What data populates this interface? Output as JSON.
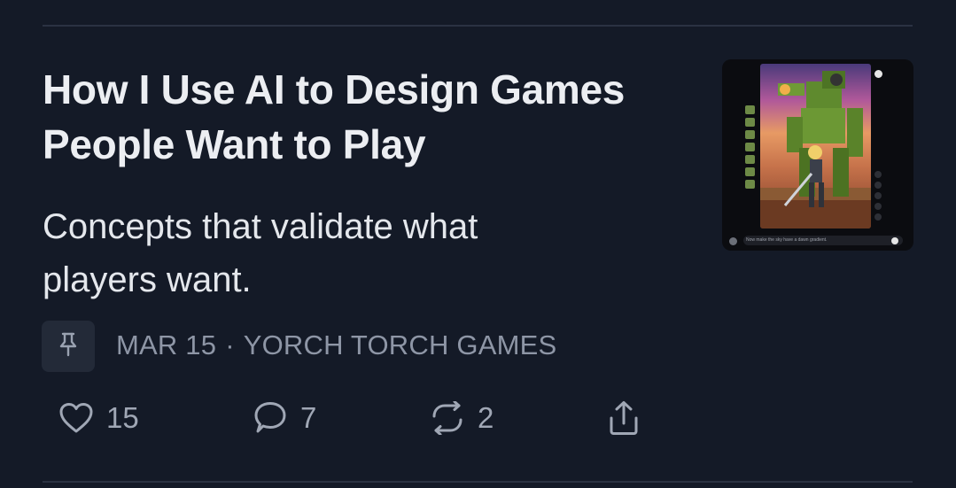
{
  "post": {
    "title": "How I Use AI to Design Games People Want to Play",
    "subtitle": "Concepts that validate what players want.",
    "date": "MAR 15",
    "separator": "·",
    "author": "YORCH TORCH GAMES",
    "thumbnail_caption": "Now make the sky have a dawn gradient."
  },
  "actions": {
    "likes": "15",
    "comments": "7",
    "restacks": "2"
  },
  "icons": {
    "pin": "pin-icon",
    "like": "heart-icon",
    "comment": "comment-icon",
    "restack": "restack-icon",
    "share": "share-icon"
  },
  "colors": {
    "background": "#141a27",
    "divider": "#2b3242",
    "meta_text": "#8e96a6"
  }
}
